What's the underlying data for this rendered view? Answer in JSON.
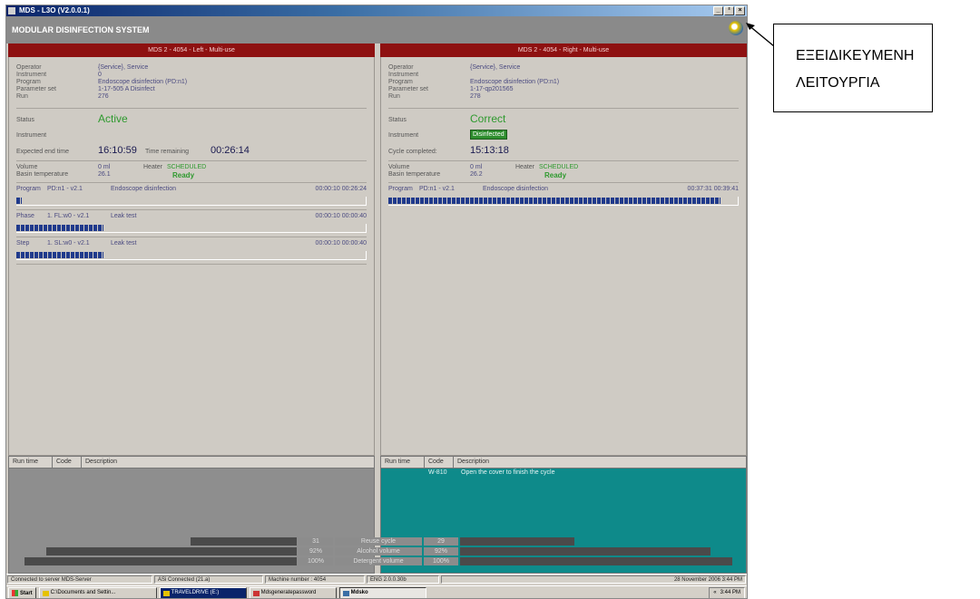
{
  "window": {
    "title": "MDS - L3O  (V2.0.0.1)",
    "controls": [
      "_",
      "²",
      "×"
    ]
  },
  "header": {
    "title": "MODULAR DISINFECTION SYSTEM"
  },
  "left": {
    "panel_title": "MDS 2 - 4054 - Left - Multi-use",
    "labels": {
      "operator": "Operator",
      "instrument": "Instrument",
      "program": "Program",
      "parameter_set": "Parameter set",
      "run": "Run"
    },
    "values": {
      "operator": "{Service}, Service",
      "instrument": "0",
      "program": "Endoscope disinfection  (PD:n1)",
      "parameter_set": "1-17-505 A Disinfect",
      "run": "276"
    },
    "status_label": "Status",
    "status_value": "Active",
    "instrument_label": "Instrument",
    "expected_label": "Expected end time",
    "expected_value": "16:10:59",
    "remaining_label": "Time remaining",
    "remaining_value": "00:26:14",
    "volume_label": "Volume",
    "volume_value": "0 ml",
    "basin_label": "Basin temperature",
    "basin_value": "26.1",
    "heater_label": "Heater",
    "heater_value": "SCHEDULED",
    "heater_state": "Ready",
    "progress": [
      {
        "name": "Program",
        "code": "PD:n1 - v2.1",
        "desc": "Endoscope disinfection",
        "times": "00:00:10  00:26:24",
        "fill": 0.015
      },
      {
        "name": "Phase",
        "code": "1. FL:w0 - v2.1",
        "desc": "Leak test",
        "times": "00:00:10  00:00:40",
        "fill": 0.25
      },
      {
        "name": "Step",
        "code": "1. SL:w0 - v2.1",
        "desc": "Leak test",
        "times": "00:00:10  00:00:40",
        "fill": 0.25
      }
    ],
    "log_headers": [
      "Run time",
      "Code",
      "Description"
    ]
  },
  "right": {
    "panel_title": "MDS 2 - 4054 - Right - Multi-use",
    "labels": {
      "operator": "Operator",
      "instrument": "Instrument",
      "program": "Program",
      "parameter_set": "Parameter set",
      "run": "Run"
    },
    "values": {
      "operator": "{Service}, Service",
      "instrument": "",
      "program": "Endoscope disinfection  (PD:n1)",
      "parameter_set": "1-17-qp201565",
      "run": "278"
    },
    "status_label": "Status",
    "status_value": "Correct",
    "instrument_label": "Instrument",
    "instrument_value": "Disinfected",
    "cycle_label": "Cycle completed:",
    "cycle_value": "15:13:18",
    "volume_label": "Volume",
    "volume_value": "0 ml",
    "basin_label": "Basin temperature",
    "basin_value": "26.2",
    "heater_label": "Heater",
    "heater_value": "SCHEDULED",
    "heater_state": "Ready",
    "progress": [
      {
        "name": "Program",
        "code": "PD:n1 - v2.1",
        "desc": "Endoscope disinfection",
        "times": "00:37:31  00:39:41",
        "fill": 0.95
      }
    ],
    "log_headers": [
      "Run time",
      "Code",
      "Description"
    ],
    "log_rows": [
      {
        "time": "",
        "code": "W-810",
        "desc": "Open the cover to finish the cycle"
      }
    ]
  },
  "resources": [
    {
      "label": "Reuse cycle",
      "left": "31",
      "right": "29",
      "left_fill": 0.39,
      "right_fill": 0.42
    },
    {
      "label": "Alcohol volume",
      "left": "92%",
      "right": "92%",
      "left_fill": 0.92,
      "right_fill": 0.92
    },
    {
      "label": "Detergent volume",
      "left": "100%",
      "right": "100%",
      "left_fill": 1.0,
      "right_fill": 1.0
    }
  ],
  "statusbar": [
    "Connected to server MDS-Server",
    "ASi Connected (21.a)",
    "Machine number : 4054",
    "ENG 2.0.0.30b",
    "28 November 2006    3:44 PM"
  ],
  "taskbar": {
    "start": "Start",
    "items": [
      "C:\\Documents and Settin...",
      "TRAVELDRIVE (E:)",
      "Mdsgeneratepassword",
      "Mdsko"
    ],
    "clock": "3:44 PM"
  },
  "callout": {
    "lines": [
      "ΕΞΕΙΔΙΚΕΥΜΕΝΗ",
      "ΛΕΙΤΟΥΡΓΙΑ"
    ]
  }
}
